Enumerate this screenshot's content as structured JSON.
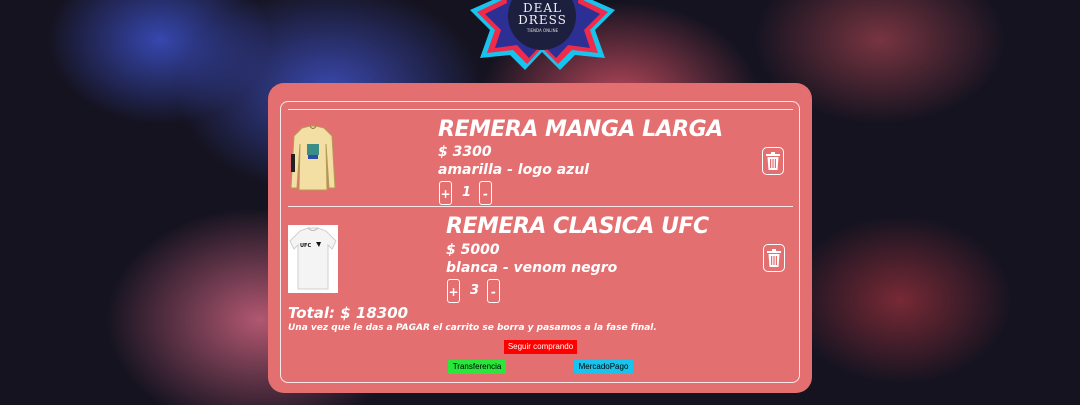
{
  "brand": {
    "line1": "DEAL",
    "line2": "DRESS",
    "tagline": "TIENDA ONLINE"
  },
  "cart": {
    "items": [
      {
        "title": "REMERA MANGA LARGA",
        "price": "$ 3300",
        "variant": "amarilla - logo azul",
        "plus": "+",
        "qty": "1",
        "minus": "-"
      },
      {
        "title": "REMERA CLASICA UFC",
        "price": "$ 5000",
        "variant": "blanca - venom negro",
        "plus": "+",
        "qty": "3",
        "minus": "-"
      }
    ],
    "total": "Total: $ 18300",
    "note": "Una vez que le das a PAGAR el carrito se borra y pasamos a la fase final."
  },
  "buttons": {
    "continue": "Seguir comprando",
    "transfer": "Transferencia",
    "mercadopago": "MercadoPago"
  },
  "colors": {
    "card": "#e46f70",
    "continue": "#ff0000",
    "transfer": "#29e63a",
    "mercadopago": "#18c3ee"
  },
  "icons": {
    "delete": "trash-icon"
  }
}
